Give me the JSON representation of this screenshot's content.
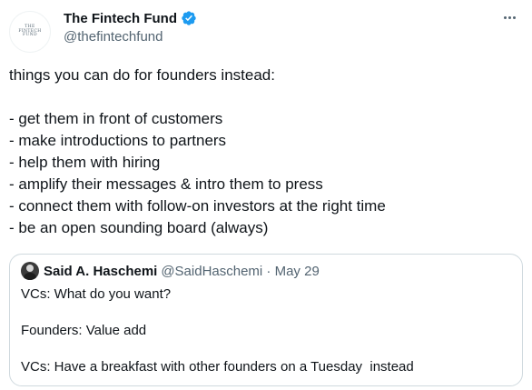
{
  "author": {
    "avatar_text": [
      "THE",
      "FINTECH",
      "FUND"
    ],
    "display_name": "The Fintech Fund",
    "handle": "@thefintechfund",
    "verified_color": "#1d9bf0"
  },
  "icons": {
    "more": "more-horizontal-icon",
    "verified": "verified-badge-icon"
  },
  "tweet": {
    "intro": "things you can do for founders instead:",
    "items": [
      "- get them in front of customers",
      "- make introductions to partners",
      "- help them with hiring",
      "- amplify their messages & intro them to press",
      "- connect them with follow-on investors at the right time",
      "- be an open sounding board (always)"
    ]
  },
  "quote": {
    "display_name": "Said A. Haschemi",
    "handle_date": "@SaidHaschemi · May 29",
    "lines": [
      "VCs: What do you want?",
      "Founders: Value add",
      "VCs: Have a breakfast with other founders on a Tuesday  instead"
    ]
  },
  "colors": {
    "text": "#0f1419",
    "secondary": "#536471",
    "border": "#cfd9de"
  }
}
